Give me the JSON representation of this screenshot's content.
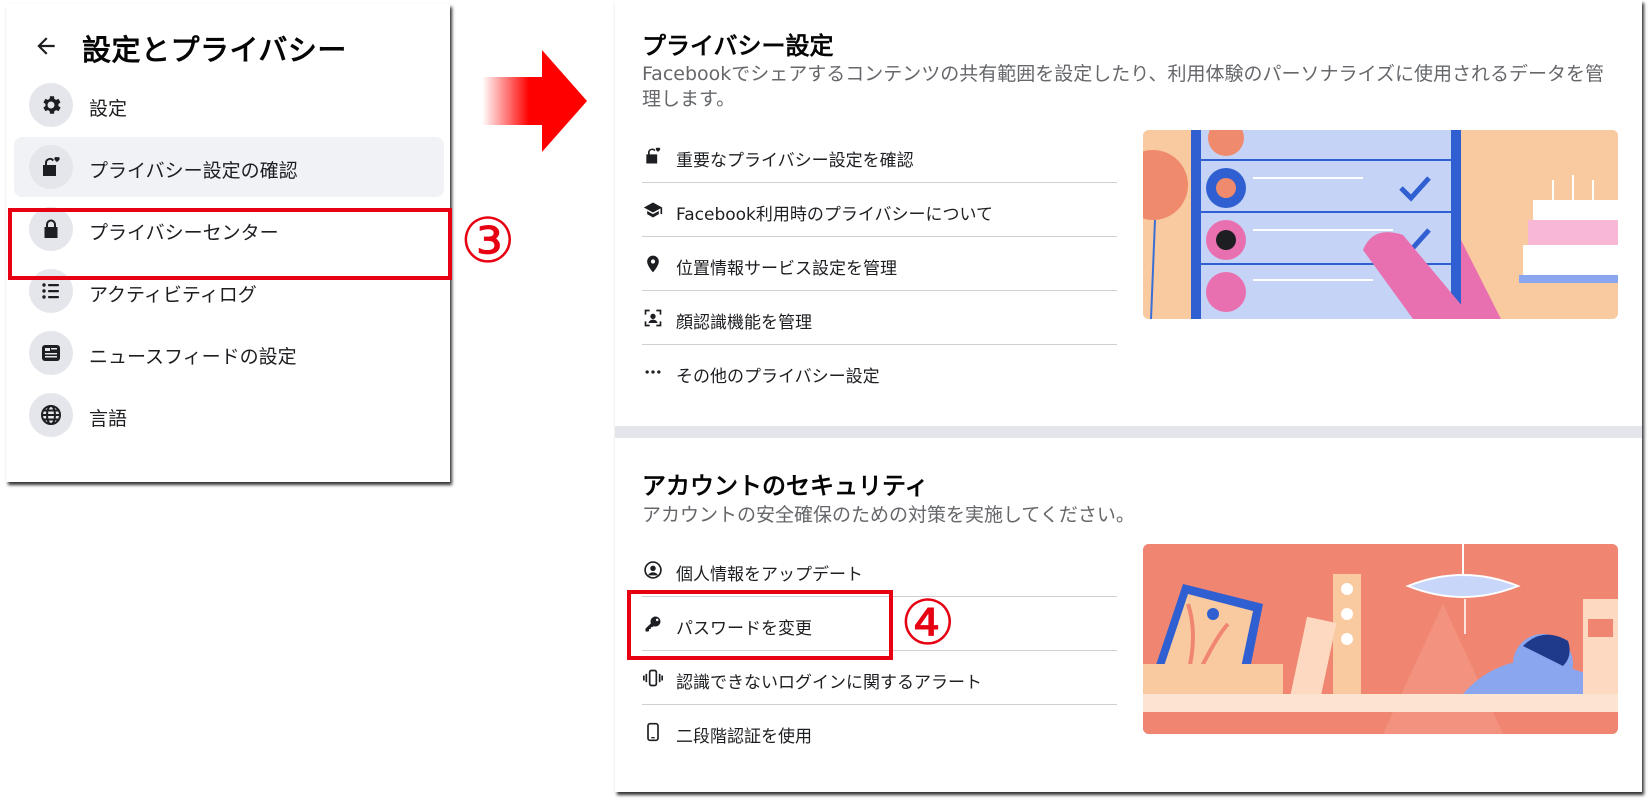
{
  "left_panel": {
    "title": "設定とプライバシー",
    "items": [
      {
        "label": "設定",
        "icon": "gear-icon"
      },
      {
        "label": "プライバシー設定の確認",
        "icon": "lock-heart-icon"
      },
      {
        "label": "プライバシーセンター",
        "icon": "lock-icon"
      },
      {
        "label": "アクティビティログ",
        "icon": "list-icon"
      },
      {
        "label": "ニュースフィードの設定",
        "icon": "news-feed-icon"
      },
      {
        "label": "言語",
        "icon": "globe-icon"
      }
    ]
  },
  "annotations": {
    "step3": "③",
    "step4": "④",
    "highlight_color": "#e60012"
  },
  "privacy_section": {
    "title": "プライバシー設定",
    "description": "Facebookでシェアするコンテンツの共有範囲を設定したり、利用体験のパーソナライズに使用されるデータを管理します。",
    "items": [
      {
        "label": "重要なプライバシー設定を確認",
        "icon": "lock-heart-icon"
      },
      {
        "label": "Facebook利用時のプライバシーについて",
        "icon": "graduation-cap-icon"
      },
      {
        "label": "位置情報サービス設定を管理",
        "icon": "location-pin-icon"
      },
      {
        "label": "顔認識機能を管理",
        "icon": "face-recognition-icon"
      },
      {
        "label": "その他のプライバシー設定",
        "icon": "more-dots-icon"
      }
    ]
  },
  "security_section": {
    "title": "アカウントのセキュリティ",
    "description": "アカウントの安全確保のための対策を実施してください。",
    "items": [
      {
        "label": "個人情報をアップデート",
        "icon": "user-circle-icon"
      },
      {
        "label": "パスワードを変更",
        "icon": "key-icon"
      },
      {
        "label": "認識できないログインに関するアラート",
        "icon": "phone-vibrate-icon"
      },
      {
        "label": "二段階認証を使用",
        "icon": "mobile-phone-icon"
      }
    ]
  }
}
